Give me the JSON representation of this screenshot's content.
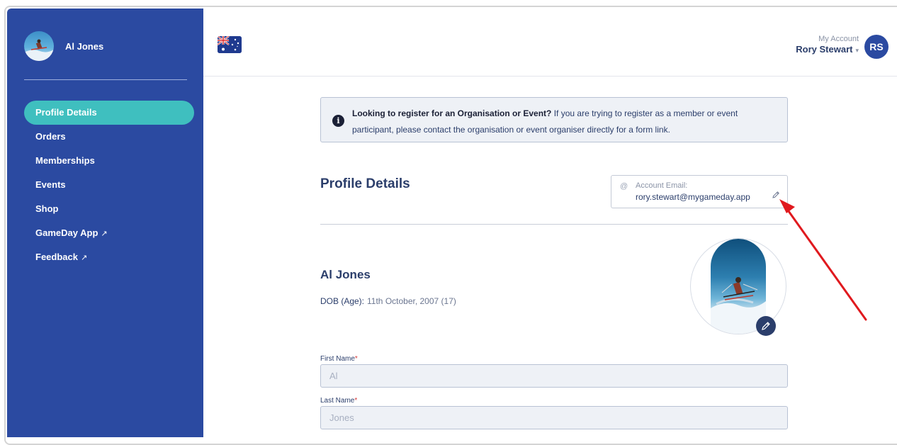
{
  "sidebar": {
    "profile_name": "Al Jones",
    "items": [
      {
        "label": "Profile Details",
        "active": true,
        "external": false
      },
      {
        "label": "Orders",
        "active": false,
        "external": false
      },
      {
        "label": "Memberships",
        "active": false,
        "external": false
      },
      {
        "label": "Events",
        "active": false,
        "external": false
      },
      {
        "label": "Shop",
        "active": false,
        "external": false
      },
      {
        "label": "GameDay App",
        "active": false,
        "external": true
      },
      {
        "label": "Feedback",
        "active": false,
        "external": true
      }
    ],
    "external_glyph": "↗"
  },
  "header": {
    "flag_icon": "australia-flag-icon",
    "account_label": "My Account",
    "account_name": "Rory Stewart",
    "account_initials": "RS"
  },
  "notice": {
    "bold": "Looking to register for an Organisation or Event?",
    "text": " If you are trying to register as a member or event participant, please contact the organisation or event organiser directly for a form link."
  },
  "profile": {
    "section_title": "Profile Details",
    "email_label": "Account Email:",
    "email_value": "rory.stewart@mygameday.app",
    "name": "Al Jones",
    "dob_label": "DOB (Age):",
    "dob_value": "11th October, 2007 (17)"
  },
  "form": {
    "first_name_label": "First Name",
    "first_name_value": "Al",
    "last_name_label": "Last Name",
    "last_name_value": "Jones",
    "required_mark": "*"
  },
  "colors": {
    "sidebar_bg": "#2b4aa1",
    "active_item": "#3fbfbf",
    "annotation_arrow": "#e0191e"
  }
}
